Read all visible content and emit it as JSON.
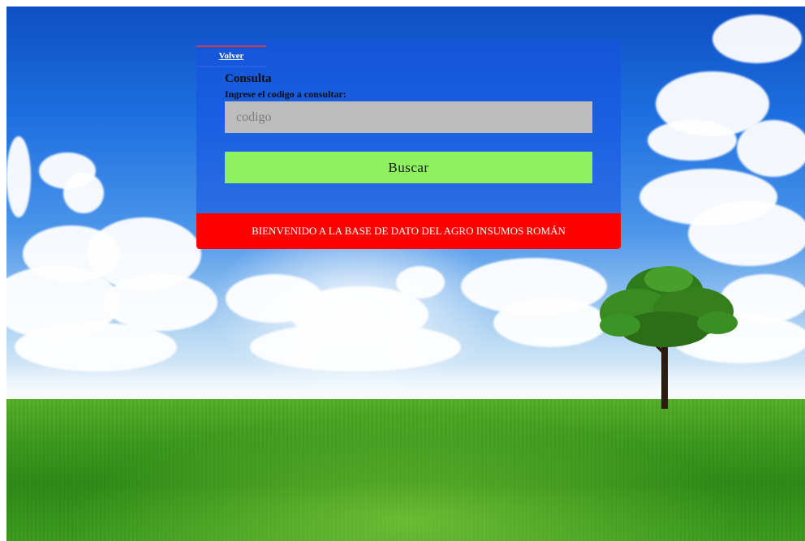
{
  "nav": {
    "back_label": "Volver"
  },
  "form": {
    "title": "Consulta",
    "prompt": "Ingrese el codigo a consultar:",
    "input_value": "",
    "input_placeholder": "codigo",
    "button_label": "Buscar"
  },
  "banner": {
    "text": "BIENVENIDO A LA BASE DE DATO DEL AGRO INSUMOS ROMÁN"
  },
  "colors": {
    "panel": "#1652e1",
    "input_bg": "#bdbdbd",
    "button_bg": "#8df25e",
    "banner_bg": "#ff0000"
  },
  "background": {
    "scene": "sky-clouds-grass-tree"
  }
}
